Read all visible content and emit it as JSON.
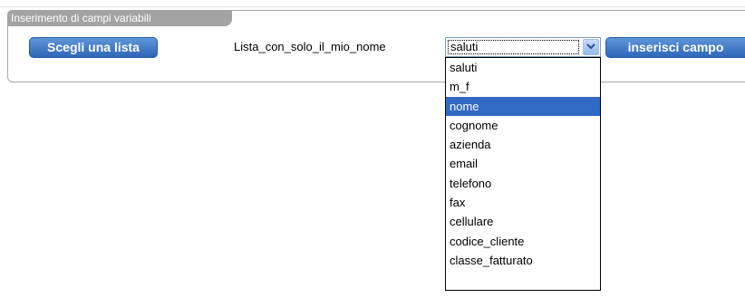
{
  "panel": {
    "legend": "Inserimento di campi variabili"
  },
  "buttons": {
    "choose_list": "Scegli una lista",
    "insert_field": "inserisci campo"
  },
  "list_name": "Lista_con_solo_il_mio_nome",
  "select": {
    "value": "saluti",
    "highlighted": "nome",
    "options": [
      "saluti",
      "m_f",
      "nome",
      "cognome",
      "azienda",
      "email",
      "telefono",
      "fax",
      "cellulare",
      "codice_cliente",
      "classe_fatturato"
    ]
  },
  "colors": {
    "accent": "#316ac5",
    "button": "#3a72c2",
    "legend_bg": "#a3a3a3"
  },
  "icons": {
    "dropdown_arrow": "chevron-down-icon"
  }
}
